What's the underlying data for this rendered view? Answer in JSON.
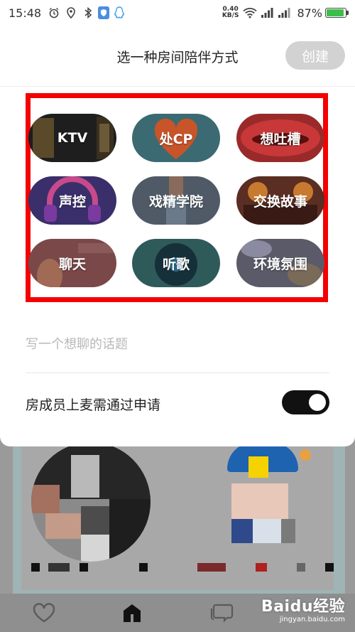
{
  "status_bar": {
    "time": "15:48",
    "icons": [
      "alarm-icon",
      "location-icon",
      "bluetooth-icon",
      "shield-icon",
      "qq-icon",
      "wifi-icon",
      "signal-icon",
      "signal-icon"
    ],
    "net_speed_value": "0.40",
    "net_speed_unit": "KB/S",
    "battery_text": "87%",
    "battery_level": 0.87
  },
  "sheet": {
    "title": "选一种房间陪伴方式",
    "create_label": "创建",
    "modes": [
      {
        "label": "KTV",
        "color": "#1e1e1e"
      },
      {
        "label": "处CP",
        "color": "#3b6a72"
      },
      {
        "label": "想吐槽",
        "color": "#9a2a2a"
      },
      {
        "label": "声控",
        "color": "#3a2f6a"
      },
      {
        "label": "戏精学院",
        "color": "#4f5a66"
      },
      {
        "label": "交换故事",
        "color": "#5a2e22"
      },
      {
        "label": "聊天",
        "color": "#7a4848"
      },
      {
        "label": "听歌",
        "color": "#2f5a5a"
      },
      {
        "label": "环境氛围",
        "color": "#5a5a68"
      }
    ],
    "topic_placeholder": "写一个想聊的话题",
    "approval_label": "房成员上麦需通过申请",
    "approval_enabled": true
  },
  "tab_bar": {
    "icons": [
      "heart-icon",
      "home-icon",
      "chat-icon"
    ]
  },
  "watermark": {
    "brand": "Baidu经验",
    "url": "jingyan.baidu.com"
  },
  "colors": {
    "highlight_border": "#f40000",
    "toggle_on": "#111111",
    "create_disabled": "#d2d2d2"
  }
}
